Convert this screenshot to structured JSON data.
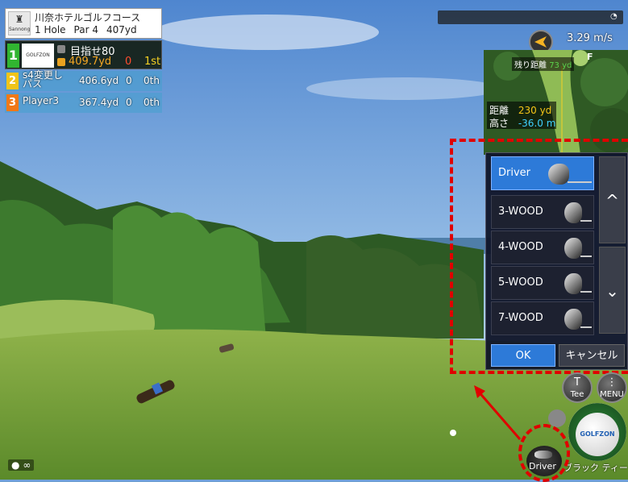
{
  "course": {
    "name": "川奈ホテルゴルフコース",
    "logo_text": "Sannong",
    "hole": "1 Hole",
    "par": "Par 4",
    "yardage": "407yd"
  },
  "players": [
    {
      "rank": "1",
      "logo_text": "GOLFZON",
      "name": "目指せ80",
      "distance": "409.7yd",
      "strokes": "0",
      "position": "1st"
    },
    {
      "rank": "2",
      "name": "s4変更しパス",
      "distance": "406.6yd",
      "strokes": "0",
      "position": "0th"
    },
    {
      "rank": "3",
      "name": "Player3",
      "distance": "367.4yd",
      "strokes": "0",
      "position": "0th"
    }
  ],
  "hud": {
    "wind_speed": "3.29 m/s",
    "remaining_label": "残り距離",
    "remaining_value": "73 yd",
    "distance_label": "距離",
    "distance_value": "230 yd",
    "height_label": "高さ",
    "height_value": "-36.0 m",
    "lie_mark": "F"
  },
  "club_menu": {
    "clubs": [
      {
        "label": "Driver",
        "selected": true
      },
      {
        "label": "3-WOOD",
        "selected": false
      },
      {
        "label": "4-WOOD",
        "selected": false
      },
      {
        "label": "5-WOOD",
        "selected": false
      },
      {
        "label": "7-WOOD",
        "selected": false
      }
    ],
    "scroll_up": "^",
    "scroll_down": "⌄",
    "ok_label": "OK",
    "cancel_label": "キャンセル"
  },
  "controls": {
    "tee_label": "Tee",
    "menu_label": "MENU",
    "current_club": "Driver",
    "tee_type": "ブラック ティー",
    "brand": "GOLFZON",
    "bottom_left": "∞"
  },
  "colors": {
    "highlight_dash": "#e00000",
    "selected_club": "#2d7ad8",
    "rank1": "#31b531",
    "rank2": "#f0c419",
    "rank3": "#f07818"
  }
}
